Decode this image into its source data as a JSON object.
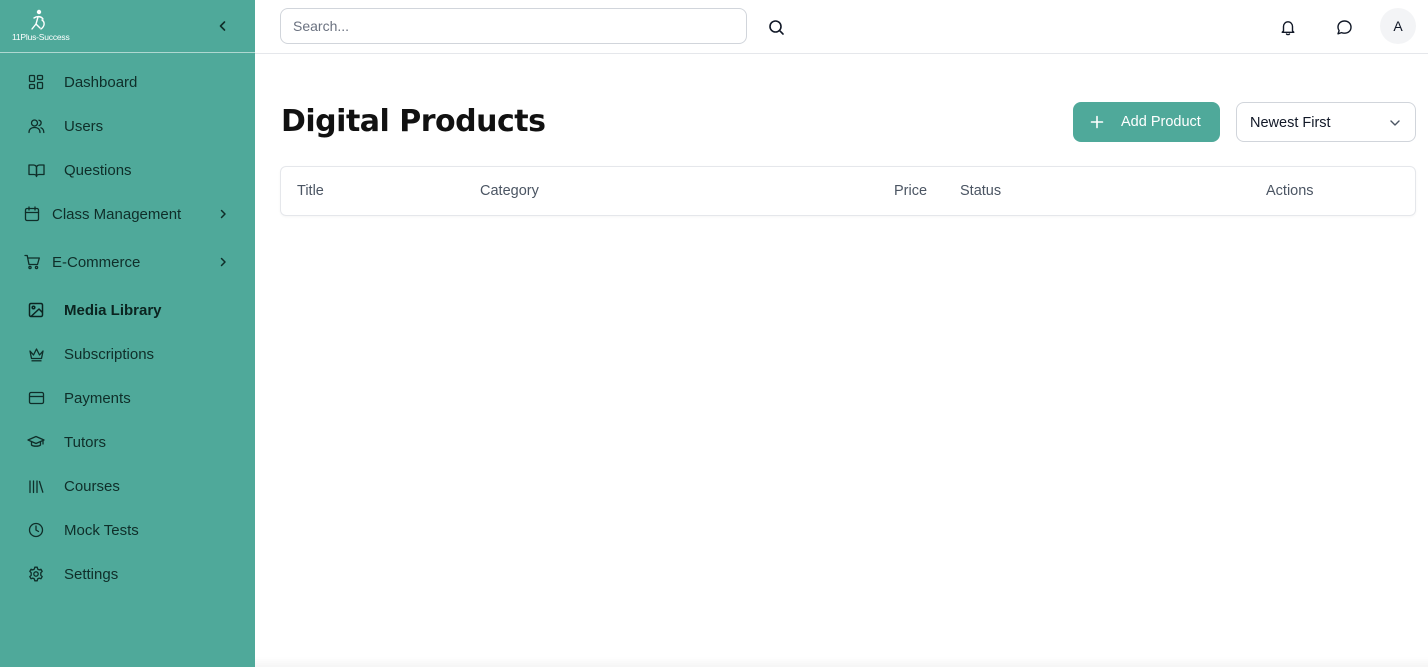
{
  "brand": {
    "logo_text": "11Plus-Success"
  },
  "sidebar": {
    "items": [
      {
        "label": "Dashboard",
        "icon": "dashboard-grid-icon"
      },
      {
        "label": "Users",
        "icon": "users-icon"
      },
      {
        "label": "Questions",
        "icon": "book-open-icon"
      },
      {
        "label": "Class Management",
        "icon": "calendar-icon",
        "expandable": true
      },
      {
        "label": "E-Commerce",
        "icon": "cart-icon",
        "expandable": true
      },
      {
        "label": "Media Library",
        "icon": "image-icon",
        "active": true
      },
      {
        "label": "Subscriptions",
        "icon": "crown-icon"
      },
      {
        "label": "Payments",
        "icon": "credit-card-icon"
      },
      {
        "label": "Tutors",
        "icon": "graduation-cap-icon"
      },
      {
        "label": "Courses",
        "icon": "library-icon"
      },
      {
        "label": "Mock Tests",
        "icon": "clock-icon"
      },
      {
        "label": "Settings",
        "icon": "gear-icon"
      }
    ]
  },
  "topbar": {
    "search_placeholder": "Search...",
    "avatar_initial": "A"
  },
  "main": {
    "title": "Digital Products",
    "add_button_label": "Add Product",
    "sort_selected": "Newest First",
    "table": {
      "columns": [
        "Title",
        "Category",
        "Price",
        "Status",
        "Actions"
      ],
      "rows": []
    }
  },
  "colors": {
    "accent": "#4fa99a",
    "sidebar_text": "#0f2e29",
    "border": "#e5e7eb"
  }
}
